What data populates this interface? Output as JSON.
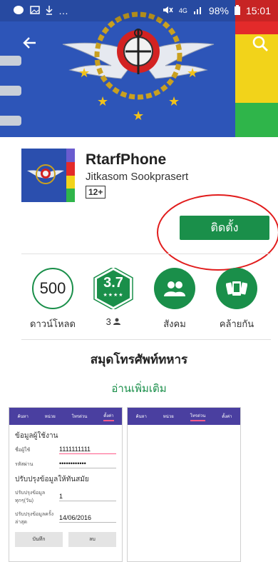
{
  "status_bar": {
    "battery": "98%",
    "time": "15:01",
    "network": "4G"
  },
  "banner": {
    "stripe_colors": [
      "#e32a2a",
      "#f2d31a",
      "#f2d31a",
      "#2fb54a"
    ]
  },
  "app": {
    "name": "RtarfPhone",
    "developer": "Jitkasom Sookprasert",
    "content_rating": "12+",
    "install_label": "ติดตั้ง"
  },
  "stats": {
    "downloads_value": "500",
    "downloads_label": "ดาวน์โหลด",
    "rating_value": "3.7",
    "rating_stars": "★★★★",
    "reviewers_count": "3",
    "social_label": "สังคม",
    "similar_label": "คล้ายกัน"
  },
  "description": {
    "title": "สมุดโทรศัพท์ทหาร",
    "read_more": "อ่านเพิ่มเติม"
  },
  "screenshot_1": {
    "tabs": [
      "ค้นหา",
      "หน่วย",
      "โทรด่วน",
      "ตั้งค่า"
    ],
    "section_user": "ข้อมูลผู้ใช้งาน",
    "username_label": "ชื่อผู้ใช้",
    "username_value": "1111111111",
    "password_label": "รหัสผ่าน",
    "password_value": "••••••••••••",
    "section_update": "ปรับปรุงข้อมูลให้ทันสมัย",
    "update_days_label": "ปรับปรุงข้อมูลทุกๆ(วัน)",
    "update_days_value": "1",
    "last_update_label": "ปรับปรุงข้อมูลครั้งล่าสุด",
    "last_update_value": "14/06/2016",
    "save_label": "บันทึก",
    "delete_label": "ลบ"
  },
  "screenshot_2": {
    "tabs": [
      "ค้นหา",
      "หน่วย",
      "โทรด่วน",
      "ตั้งค่า"
    ]
  },
  "colors": {
    "install_green": "#1a8f4a",
    "highlight_red": "#e11c1c",
    "banner_blue": "#2d55b8"
  }
}
